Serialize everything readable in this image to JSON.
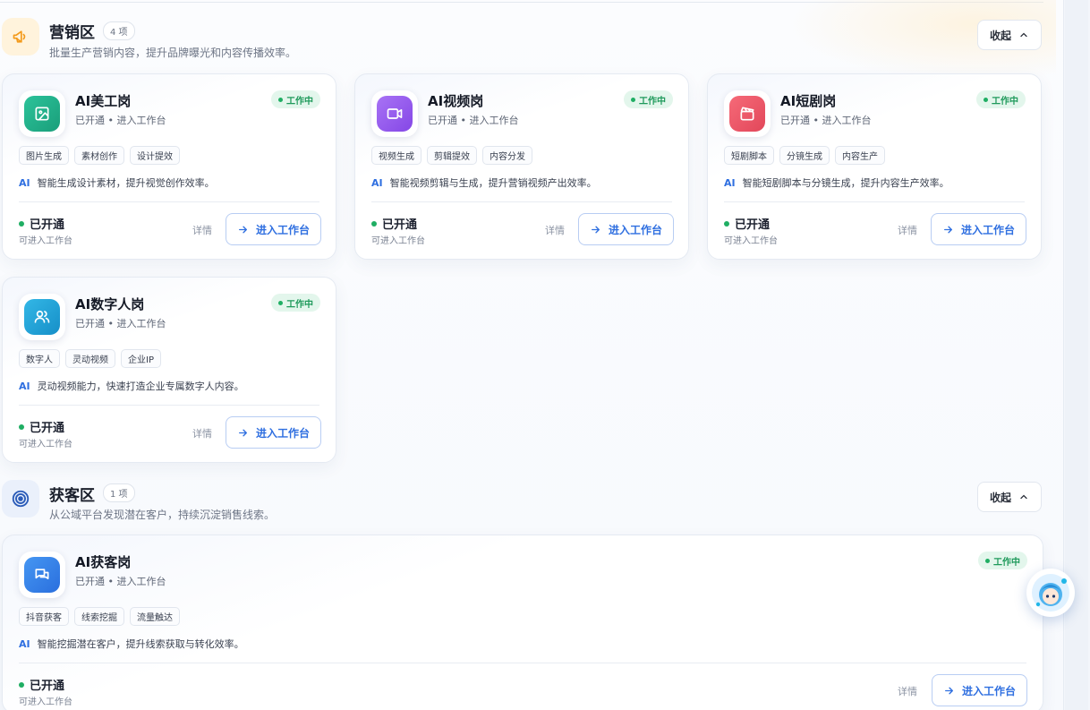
{
  "sections": [
    {
      "title": "营销区",
      "count": "4 项",
      "description": "批量生产营销内容，提升品牌曝光和内容传播效率。",
      "collapse_label": "收起",
      "icon": "megaphone-icon"
    },
    {
      "title": "获客区",
      "count": "1 项",
      "description": "从公域平台发现潜在客户，持续沉淀销售线索。",
      "collapse_label": "收起",
      "icon": "target-icon"
    }
  ],
  "cards": [
    {
      "name": "AI美工岗",
      "sub": "已开通 • 进入工作台",
      "status": "工作中",
      "tags": [
        "图片生成",
        "素材创作",
        "设计提效"
      ],
      "ai_label": "AI",
      "desc": "智能生成设计素材，提升视觉创作效率。",
      "open_state": "已开通",
      "open_hint": "可进入工作台",
      "detail": "详情",
      "enter": "进入工作台",
      "icon": "image-icon",
      "color": "#22b08a"
    },
    {
      "name": "AI视频岗",
      "sub": "已开通 • 进入工作台",
      "status": "工作中",
      "tags": [
        "视频生成",
        "剪辑提效",
        "内容分发"
      ],
      "ai_label": "AI",
      "desc": "智能视频剪辑与生成，提升营销视频产出效率。",
      "open_state": "已开通",
      "open_hint": "可进入工作台",
      "detail": "详情",
      "enter": "进入工作台",
      "icon": "video-icon",
      "color": "#9a5cf0"
    },
    {
      "name": "AI短剧岗",
      "sub": "已开通 • 进入工作台",
      "status": "工作中",
      "tags": [
        "短剧脚本",
        "分镜生成",
        "内容生产"
      ],
      "ai_label": "AI",
      "desc": "智能短剧脚本与分镜生成，提升内容生产效率。",
      "open_state": "已开通",
      "open_hint": "可进入工作台",
      "detail": "详情",
      "enter": "进入工作台",
      "icon": "clapperboard-icon",
      "color": "#ef5a6a"
    },
    {
      "name": "AI数字人岗",
      "sub": "已开通 • 进入工作台",
      "status": "工作中",
      "tags": [
        "数字人",
        "灵动视频",
        "企业IP"
      ],
      "ai_label": "AI",
      "desc": "灵动视频能力，快速打造企业专属数字人内容。",
      "open_state": "已开通",
      "open_hint": "可进入工作台",
      "detail": "详情",
      "enter": "进入工作台",
      "icon": "users-icon",
      "color": "#22a3d8"
    },
    {
      "name": "AI获客岗",
      "sub": "已开通 • 进入工作台",
      "status": "工作中",
      "tags": [
        "抖音获客",
        "线索挖掘",
        "流量触达"
      ],
      "ai_label": "AI",
      "desc": "智能挖掘潜在客户，提升线索获取与转化效率。",
      "open_state": "已开通",
      "open_hint": "可进入工作台",
      "detail": "详情",
      "enter": "进入工作台",
      "icon": "chat-icon",
      "color": "#3a86ea"
    }
  ],
  "colors": {
    "accent": "#2f6fe0",
    "status_green": "#1fae63",
    "marketing_icon": "#f39a1a",
    "acq_icon": "#2a5bb8"
  }
}
